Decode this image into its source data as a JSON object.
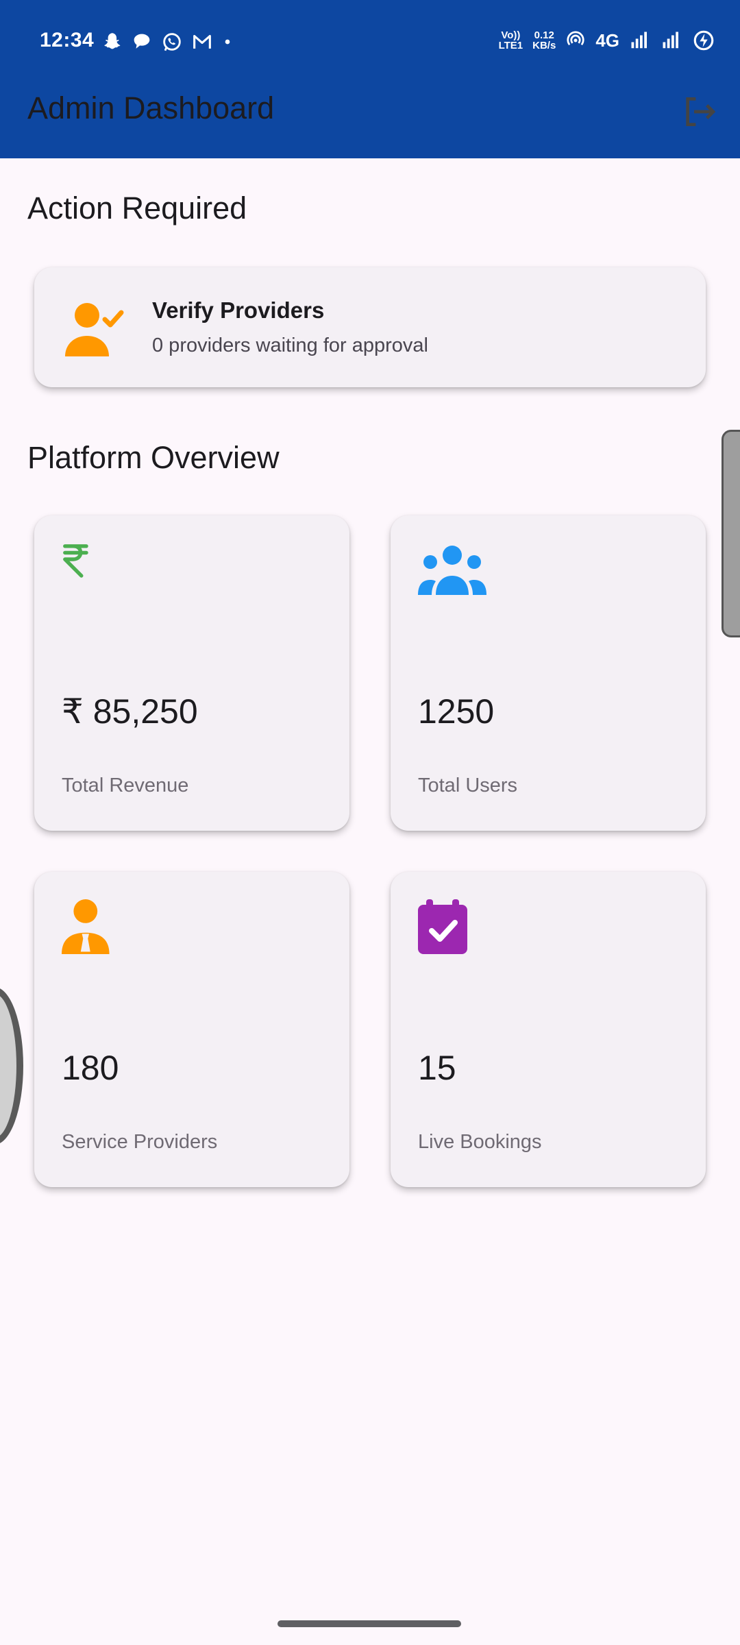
{
  "status_bar": {
    "time": "12:34",
    "notification_icons": [
      "snapchat-icon",
      "chat-icon",
      "whatsapp-icon",
      "gmail-icon",
      "dot-icon"
    ],
    "volte": [
      "Vo))",
      "LTE1"
    ],
    "speed": [
      "0.12",
      "KB/s"
    ],
    "network": "4G"
  },
  "app_bar": {
    "title": "Admin Dashboard",
    "logout_icon": "logout-icon"
  },
  "action_required": {
    "heading": "Action Required",
    "verify_card": {
      "title": "Verify Providers",
      "subtitle": "0 providers waiting for approval",
      "icon": "person-check-icon",
      "icon_color": "#ff9800"
    }
  },
  "platform_overview": {
    "heading": "Platform Overview",
    "stats": [
      {
        "value": "₹ 85,250",
        "label": "Total Revenue",
        "icon": "rupee-icon",
        "color": "#4caf50"
      },
      {
        "value": "1250",
        "label": "Total Users",
        "icon": "group-icon",
        "color": "#2196f3"
      },
      {
        "value": "180",
        "label": "Service Providers",
        "icon": "person-tie-icon",
        "color": "#ff9800"
      },
      {
        "value": "15",
        "label": "Live Bookings",
        "icon": "calendar-check-icon",
        "color": "#9c27b0"
      }
    ]
  },
  "colors": {
    "app_bar": "#0d47a1",
    "background": "#fdf7fc",
    "card": "#f4f0f5"
  }
}
